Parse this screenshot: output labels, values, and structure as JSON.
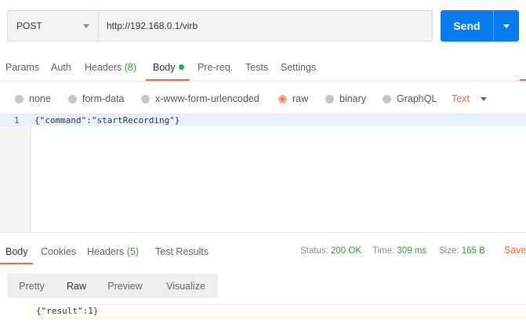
{
  "request": {
    "method": "POST",
    "url": "http://192.168.0.1/virb",
    "send_label": "Send"
  },
  "request_tabs": [
    {
      "label": "Params"
    },
    {
      "label": "Auth"
    },
    {
      "label": "Headers",
      "count": "(8)"
    },
    {
      "label": "Body"
    },
    {
      "label": "Pre-req."
    },
    {
      "label": "Tests"
    },
    {
      "label": "Settings"
    }
  ],
  "body_types": [
    {
      "label": "none"
    },
    {
      "label": "form-data"
    },
    {
      "label": "x-www-form-urlencoded"
    },
    {
      "label": "raw"
    },
    {
      "label": "binary"
    },
    {
      "label": "GraphQL"
    }
  ],
  "body_format": "Text",
  "editor": {
    "line_number": "1",
    "code": "{\"command\":\"startRecording\"}"
  },
  "response_tabs": [
    {
      "label": "Body"
    },
    {
      "label": "Cookies"
    },
    {
      "label": "Headers",
      "count": "(5)"
    },
    {
      "label": "Test Results"
    }
  ],
  "response_status": {
    "status_label": "Status:",
    "status_value": "200 OK",
    "time_label": "Time:",
    "time_value": "309 ms",
    "size_label": "Size:",
    "size_value": "165 B",
    "save_label": "Save"
  },
  "view_modes": [
    {
      "label": "Pretty"
    },
    {
      "label": "Raw"
    },
    {
      "label": "Preview"
    },
    {
      "label": "Visualize"
    }
  ],
  "response_body": "{\"result\":1}",
  "colors": {
    "accent": "#f26b3a",
    "send_button": "#097bed",
    "success": "#3a9a3a",
    "body_dot": "#2fa94e"
  }
}
